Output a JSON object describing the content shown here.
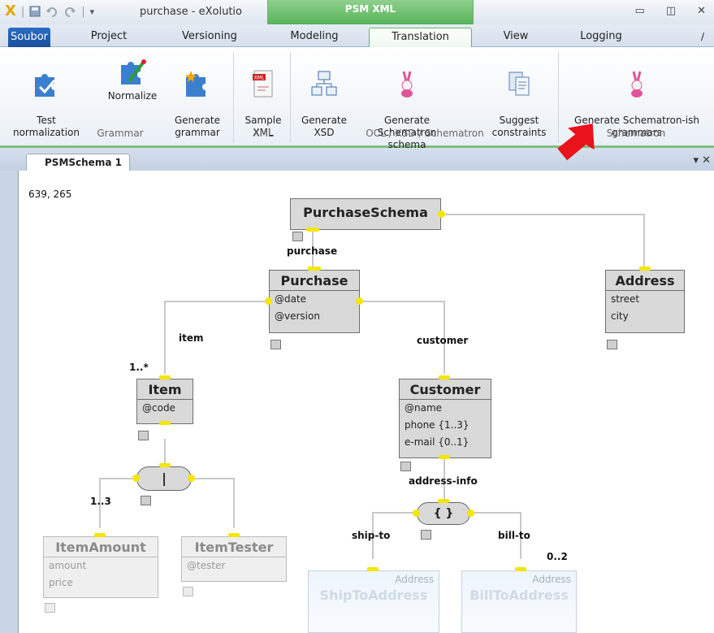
{
  "titlebar": {
    "title": "purchase - eXolutio",
    "context_tab_group": "PSM XML",
    "qat_icons": [
      "app-logo-icon",
      "save-icon",
      "undo-icon",
      "redo-icon",
      "customize-icon"
    ]
  },
  "tabs": {
    "file": "Soubor",
    "project": "Project",
    "versioning": "Versioning",
    "modeling": "Modeling",
    "translation": "Translation",
    "view": "View",
    "logging": "Logging"
  },
  "ribbon": {
    "buttons": {
      "test_normalization": "Test\nnormalization",
      "normalize": "Normalize",
      "generate_grammar": "Generate\ngrammar",
      "sample_xml": "Sample\nXML",
      "generate_xsd": "Generate\nXSD",
      "generate_schematron_schema": "Generate\nSchematron schema",
      "suggest_constraints": "Suggest\nconstraints",
      "generate_schematron_ish": "Generate Schematron-ish\ngrammars"
    },
    "groups": {
      "grammar": "Grammar",
      "xml": "XML",
      "ocl": "OCL / XSD / Schematron",
      "schematron": "Schematron"
    },
    "sample_icon_text": "XML"
  },
  "document": {
    "tab_title": "PSMSchema 1",
    "controls": "▾ ✕"
  },
  "canvas": {
    "coords": "639, 265",
    "nodes": {
      "purchase_schema": {
        "title": "PurchaseSchema"
      },
      "purchase": {
        "title": "Purchase",
        "attrs": [
          "@date",
          "@version"
        ]
      },
      "address": {
        "title": "Address",
        "attrs": [
          "street",
          "city"
        ]
      },
      "item": {
        "title": "Item",
        "attrs": [
          "@code"
        ]
      },
      "customer": {
        "title": "Customer",
        "attrs": [
          "@name",
          "phone {1..3}",
          "e-mail {0..1}"
        ]
      },
      "item_amount": {
        "title": "ItemAmount",
        "attrs": [
          "amount",
          "price"
        ]
      },
      "item_tester": {
        "title": "ItemTester",
        "attrs": [
          "@tester"
        ]
      },
      "ship_to": {
        "title": "ShipToAddress",
        "ref": "Address"
      },
      "bill_to": {
        "title": "BillToAddress",
        "ref": "Address"
      }
    },
    "choice_symbol": "|",
    "set_symbol": "{ }",
    "labels": {
      "purchase": "purchase",
      "item": "item",
      "customer": "customer",
      "address_info": "address-info",
      "ship_to": "ship-to",
      "bill_to": "bill-to",
      "card_item": "1..*",
      "card_amount": "1..3",
      "card_bill": "0..2"
    }
  },
  "colors": {
    "accent_green": "#54b254",
    "file_tab_blue": "#1b4f9c",
    "connector_yellow": "#f3e600",
    "annotation_arrow": "#e8131b"
  }
}
